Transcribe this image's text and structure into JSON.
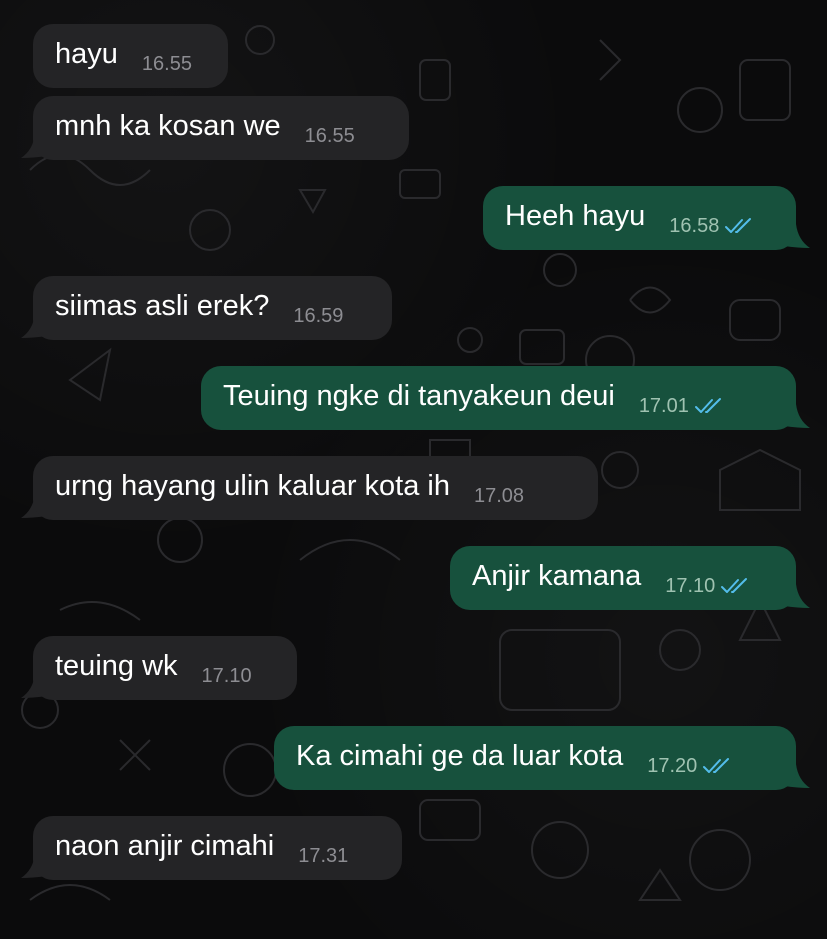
{
  "messages": [
    {
      "direction": "in",
      "text": "hayu",
      "time": "16.55"
    },
    {
      "direction": "in",
      "text": "mnh ka kosan we",
      "time": "16.55"
    },
    {
      "direction": "out",
      "text": "Heeh hayu",
      "time": "16.58",
      "status": "read"
    },
    {
      "direction": "in",
      "text": "siimas asli erek?",
      "time": "16.59"
    },
    {
      "direction": "out",
      "text": "Teuing ngke di tanyakeun deui",
      "time": "17.01",
      "status": "read"
    },
    {
      "direction": "in",
      "text": "urng hayang ulin kaluar kota ih",
      "time": "17.08"
    },
    {
      "direction": "out",
      "text": "Anjir kamana",
      "time": "17.10",
      "status": "read"
    },
    {
      "direction": "in",
      "text": "teuing wk",
      "time": "17.10"
    },
    {
      "direction": "out",
      "text": "Ka cimahi ge da luar kota",
      "time": "17.20",
      "status": "read"
    },
    {
      "direction": "in",
      "text": "naon anjir cimahi",
      "time": "17.31"
    }
  ],
  "colors": {
    "background": "#0b0b0c",
    "incoming_bubble": "#242426",
    "outgoing_bubble": "#17513d",
    "read_ticks": "#53bdeb"
  }
}
